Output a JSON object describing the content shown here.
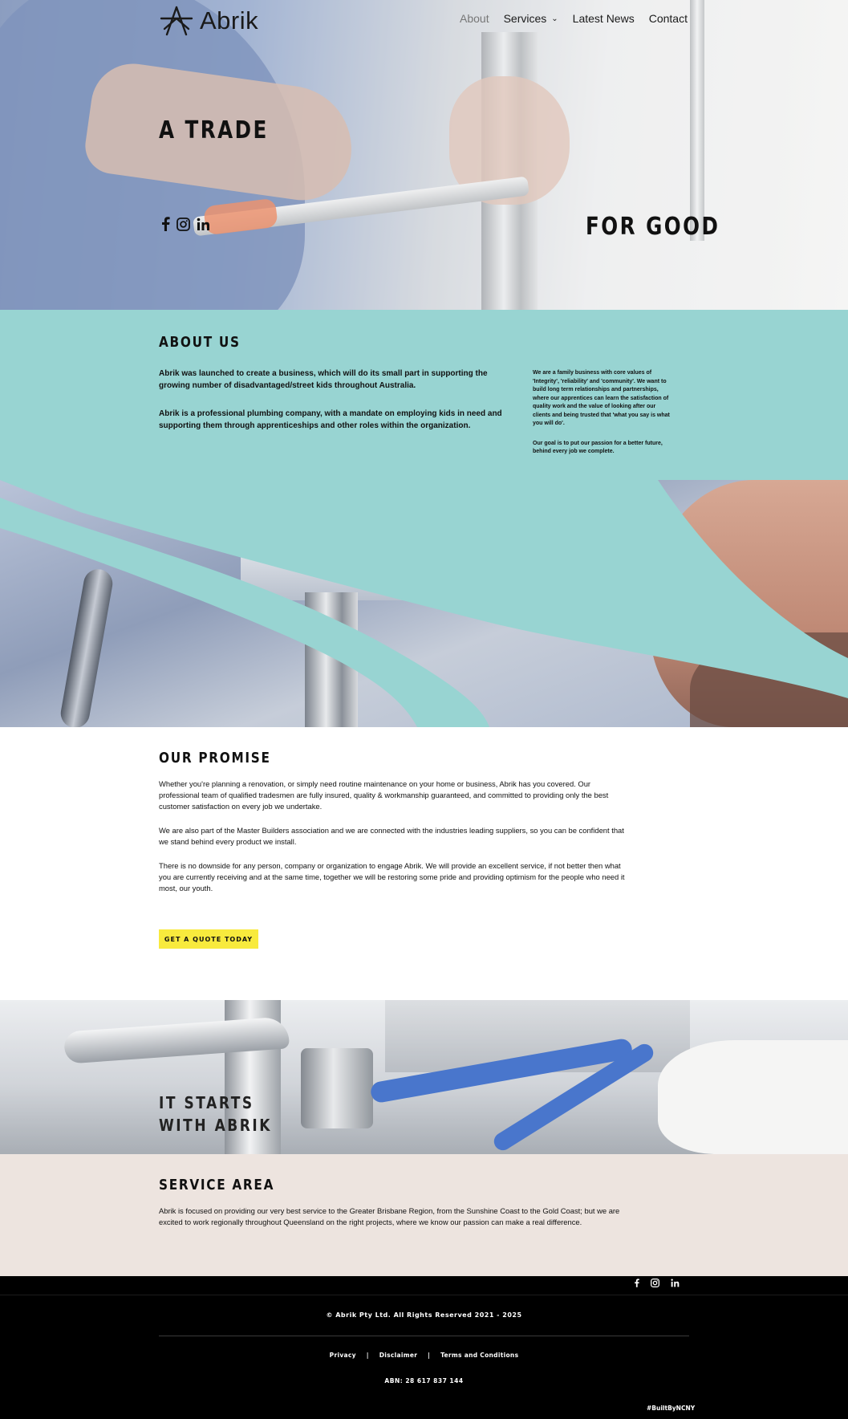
{
  "brand": {
    "logo_text": "Abrik"
  },
  "nav": {
    "items": [
      {
        "label": "About",
        "active": true
      },
      {
        "label": "Services",
        "has_dropdown": true
      },
      {
        "label": "Latest News"
      },
      {
        "label": "Contact"
      }
    ]
  },
  "hero": {
    "title_left": "A TRADE",
    "title_right": "FOR GOOD",
    "social_icons": [
      "facebook-icon",
      "instagram-icon",
      "linkedin-icon"
    ]
  },
  "about": {
    "heading": "ABOUT US",
    "col1": [
      "Abrik was launched to create a business, which will do its small part in supporting the growing number of disadvantaged/street kids throughout Australia.",
      "Abrik is a professional plumbing company, with a mandate on employing kids in need and supporting them through apprenticeships and other roles within the organization."
    ],
    "col2": [
      "We are a family business with core values of 'Integrity', 'reliability' and 'community'. We want to build long term relationships and partnerships, where our apprentices can learn the satisfaction of quality work and the value of looking after our clients and being trusted that 'what you say is what you will do'.",
      "Our goal is to put our passion for a better future, behind every job we complete."
    ]
  },
  "promise": {
    "heading": "OUR PROMISE",
    "paragraphs": [
      "Whether you're planning a renovation, or simply need routine maintenance on your home or business, Abrik has you covered. Our professional team of qualified tradesmen are fully insured, quality & workmanship guaranteed, and committed to providing only the best customer satisfaction on every job we undertake.",
      "We are also part of the Master Builders association and we are connected with the industries leading suppliers, so you can be confident that we stand behind every product we install.",
      "There is no downside for any person, company or organization to engage Abrik. We will provide an excellent service, if not better then what you are currently receiving and at the same time, together we will be restoring some pride and providing optimism for the people who need it most, our youth."
    ],
    "cta_label": "GET A QUOTE TODAY"
  },
  "banner": {
    "line1": "IT STARTS",
    "line2": "WITH ABRIK"
  },
  "service_area": {
    "heading": "SERVICE AREA",
    "body": "Abrik is focused on providing our very best service to the Greater Brisbane Region, from the Sunshine Coast to the Gold Coast; but we are excited to work regionally throughout Queensland on the right projects, where we know our passion can make a real difference."
  },
  "footer": {
    "social_icons": [
      "facebook-icon",
      "instagram-icon",
      "linkedin-icon"
    ],
    "copyright": "© Abrik Pty Ltd. All Rights Reserved 2021 - 2025",
    "links": [
      "Privacy",
      "Disclaimer",
      "Terms and Conditions"
    ],
    "abn": "ABN: 28 617 837 144",
    "built_by": "#BuiltByNCNY"
  },
  "colors": {
    "teal": "#98d4d2",
    "cta_yellow": "#f8ea3d",
    "service_bg": "#ede4df",
    "footer_bg": "#000000"
  }
}
